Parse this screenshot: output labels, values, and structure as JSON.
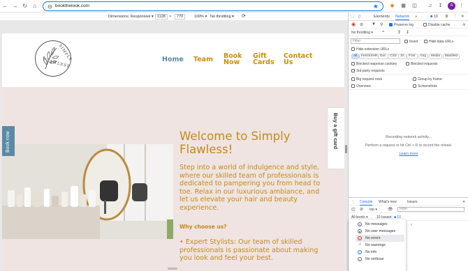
{
  "browser": {
    "url": "bookthelook.com",
    "avatar_letter": "A",
    "accent": "#1a73e8"
  },
  "device_toolbar": {
    "dimensions_label": "Dimensions: Responsive",
    "width": "1128",
    "height": "770",
    "zoom": "100%",
    "throttling": "No throttling"
  },
  "site": {
    "nav": {
      "home": "Home",
      "team": "Team",
      "book_now": "Book Now",
      "gift_cards": "Gift Cards",
      "contact_us": "Contact Us"
    },
    "logo_text_top": "SIMPLY",
    "logo_text_bottom": "FLAWLESS",
    "book_now_tab": "Book now",
    "gift_card_tab": "Buy a gift card",
    "welcome": "Welcome to Simply Flawless!",
    "intro": "Step into a world of indulgence and style, where our skilled team of professionals is dedicated to pampering you from head to toe. Relax in our luxurious ambiance, and let us elevate your hair and beauty experience.",
    "why_heading": "Why choose us?",
    "expert": "• Expert Stylists: Our team of skilled professionals is passionate about making you look and feel your best.",
    "colors": {
      "gold": "#c38a1a",
      "blue": "#5a8aa5",
      "pink_bg": "#efe4e2"
    }
  },
  "devtools": {
    "tabs": [
      "Elements",
      "Network"
    ],
    "issues_count": "10",
    "preserve_log": "Preserve log",
    "disable_cache": "Disable cache",
    "no_throttling": "No throttling",
    "filter_placeholder": "Filter",
    "invert": "Invert",
    "hide_data_urls": "Hide data URLs",
    "hide_extension_urls": "Hide extension URLs",
    "type_filters": [
      "All",
      "Fetch/XHR",
      "Doc",
      "CSS",
      "JS",
      "Font",
      "Img",
      "Media",
      "Manifest"
    ],
    "blocked_cookies": "Blocked response cookies",
    "blocked_requests": "Blocked requests",
    "third_party": "3rd-party requests",
    "big_request_rows": "Big request rows",
    "group_by_frame": "Group by frame",
    "overview": "Overview",
    "screenshots": "Screenshots",
    "recording": "Recording network activity...",
    "perform": "Perform a request or hit Ctrl + R to record the reload.",
    "learn_more": "Learn more",
    "drawer_tabs": [
      "Console",
      "What's new",
      "Issues"
    ],
    "context": "top",
    "console_filter_placeholder": "Filter",
    "all_levels": "All levels",
    "issues_text": "10 Issues:",
    "issues_badge": "10",
    "menu": [
      "No messages",
      "No user messages",
      "No errors",
      "No warnings",
      "No info",
      "No verbose"
    ]
  }
}
